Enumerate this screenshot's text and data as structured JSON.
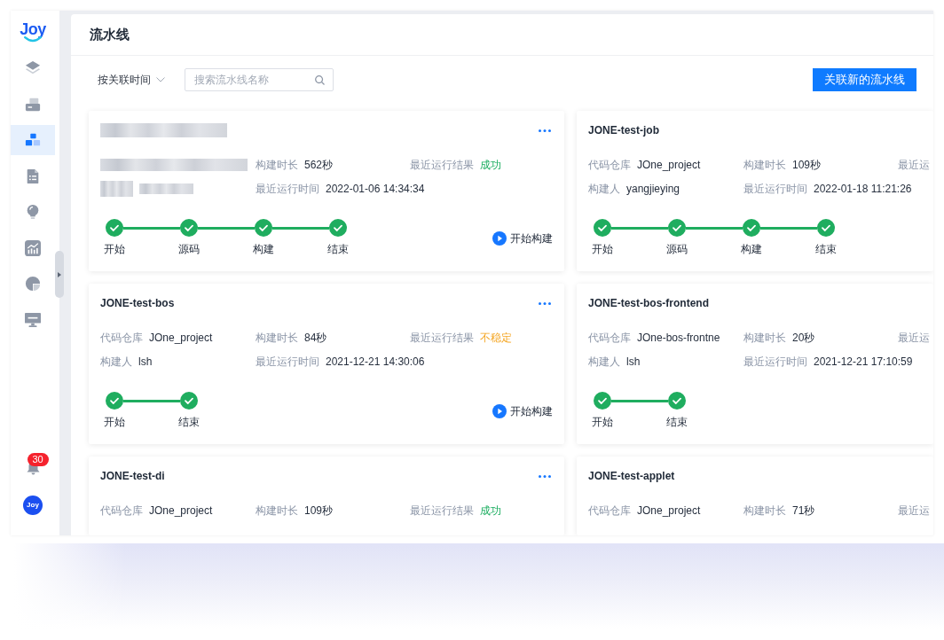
{
  "sidebar": {
    "logo": "Joy",
    "nav": [
      {
        "selected": false
      },
      {
        "selected": false
      },
      {
        "selected": true
      },
      {
        "selected": false
      },
      {
        "selected": false
      },
      {
        "selected": false
      },
      {
        "selected": false
      },
      {
        "selected": false
      }
    ],
    "notifications": {
      "count": "30"
    },
    "avatar": {
      "text": "Joy"
    }
  },
  "header": {
    "title": "流水线"
  },
  "toolbar": {
    "sort": {
      "label": "按关联时间"
    },
    "search": {
      "placeholder": "搜索流水线名称"
    },
    "primary_button": "关联新的流水线"
  },
  "card_rows": [
    {
      "cards": [
        {
          "title_redacted": true,
          "menu": true,
          "rows": [
            [
              {
                "kind": "redacted"
              },
              {
                "kind": "text",
                "label": "构建时长",
                "value": "562秒"
              },
              {
                "kind": "text",
                "label": "最近运行结果",
                "value": "成功",
                "color": "#1aad5f"
              }
            ],
            [
              {
                "kind": "redacted_pair"
              },
              {
                "kind": "text",
                "label": "最近运行时间",
                "value": "2022-01-06 14:34:34"
              }
            ]
          ],
          "stages": [
            {
              "label": "开始",
              "done": true
            },
            {
              "label": "源码",
              "done": true
            },
            {
              "label": "构建",
              "done": true
            },
            {
              "label": "结束",
              "done": true
            }
          ],
          "action": "开始构建"
        },
        {
          "title": "JONE-test-job",
          "title_redacted": false,
          "menu": false,
          "rows": [
            [
              {
                "kind": "text",
                "label": "代码仓库",
                "value": "JOne_project"
              },
              {
                "kind": "text",
                "label": "构建时长",
                "value": "109秒"
              },
              {
                "kind": "text",
                "label": "最近运"
              }
            ],
            [
              {
                "kind": "text",
                "label": "构建人",
                "value": "yangjieying"
              },
              {
                "kind": "text",
                "label": "最近运行时间",
                "value": "2022-01-18 11:21:26"
              }
            ]
          ],
          "stages": [
            {
              "label": "开始",
              "done": true
            },
            {
              "label": "源码",
              "done": true
            },
            {
              "label": "构建",
              "done": true
            },
            {
              "label": "结束",
              "done": true
            }
          ]
        }
      ]
    },
    {
      "cards": [
        {
          "title": "JONE-test-bos",
          "title_redacted": false,
          "menu": true,
          "rows": [
            [
              {
                "kind": "text",
                "label": "代码仓库",
                "value": "JOne_project"
              },
              {
                "kind": "text",
                "label": "构建时长",
                "value": "84秒"
              },
              {
                "kind": "text",
                "label": "最近运行结果",
                "value": "不稳定",
                "color": "#f5a623"
              }
            ],
            [
              {
                "kind": "text",
                "label": "构建人",
                "value": "lsh"
              },
              {
                "kind": "text",
                "label": "最近运行时间",
                "value": "2021-12-21 14:30:06"
              }
            ]
          ],
          "stages": [
            {
              "label": "开始",
              "done": true
            },
            {
              "label": "结束",
              "done": true
            }
          ],
          "action": "开始构建"
        },
        {
          "title": "JONE-test-bos-frontend",
          "title_redacted": false,
          "menu": false,
          "rows": [
            [
              {
                "kind": "text",
                "label": "代码仓库",
                "value": "JOne-bos-frontne"
              },
              {
                "kind": "text",
                "label": "构建时长",
                "value": "20秒"
              },
              {
                "kind": "text",
                "label": "最近运"
              }
            ],
            [
              {
                "kind": "text",
                "label": "构建人",
                "value": "lsh"
              },
              {
                "kind": "text",
                "label": "最近运行时间",
                "value": "2021-12-21 17:10:59"
              }
            ]
          ],
          "stages": [
            {
              "label": "开始",
              "done": true
            },
            {
              "label": "结束",
              "done": true
            }
          ]
        }
      ]
    },
    {
      "cards": [
        {
          "title": "JONE-test-di",
          "title_redacted": false,
          "menu": true,
          "rows": [
            [
              {
                "kind": "text",
                "label": "代码仓库",
                "value": "JOne_project"
              },
              {
                "kind": "text",
                "label": "构建时长",
                "value": "109秒"
              },
              {
                "kind": "text",
                "label": "最近运行结果",
                "value": "成功",
                "color": "#1aad5f"
              }
            ]
          ]
        },
        {
          "title": "JONE-test-applet",
          "title_redacted": false,
          "menu": false,
          "rows": [
            [
              {
                "kind": "text",
                "label": "代码仓库",
                "value": "JOne_project"
              },
              {
                "kind": "text",
                "label": "构建时长",
                "value": "71秒"
              },
              {
                "kind": "text",
                "label": "最近运"
              }
            ]
          ]
        }
      ]
    }
  ]
}
